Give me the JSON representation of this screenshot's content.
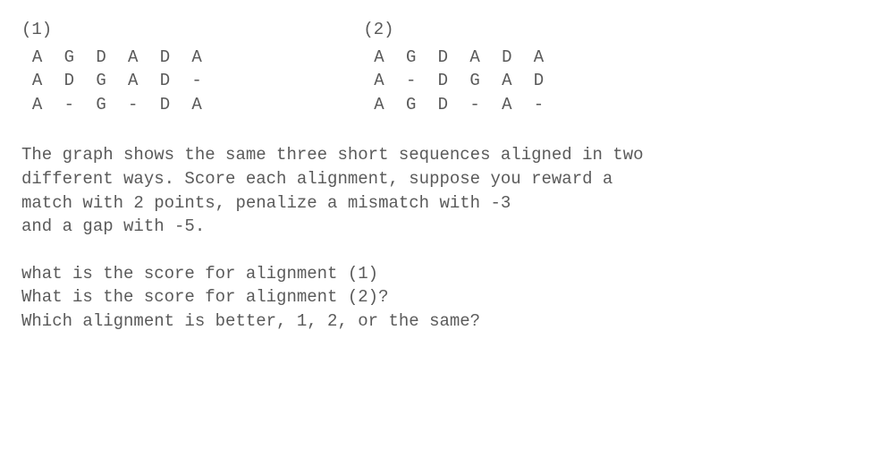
{
  "alignments": [
    {
      "label": "(1)",
      "rows": [
        " A  G  D  A  D  A",
        " A  D  G  A  D  -",
        " A  -  G  -  D  A"
      ]
    },
    {
      "label": "(2)",
      "rows": [
        " A  G  D  A  D  A",
        " A  -  D  G  A  D",
        " A  G  D  -  A  -"
      ]
    }
  ],
  "paragraph": "The graph shows the same three short sequences aligned in two\ndifferent ways. Score each alignment, suppose you reward a\nmatch with 2 points, penalize a mismatch with -3\nand a gap with -5.",
  "questions": "what is the score for alignment (1)\nWhat is the score for alignment (2)?\nWhich alignment is better, 1, 2, or the same?"
}
